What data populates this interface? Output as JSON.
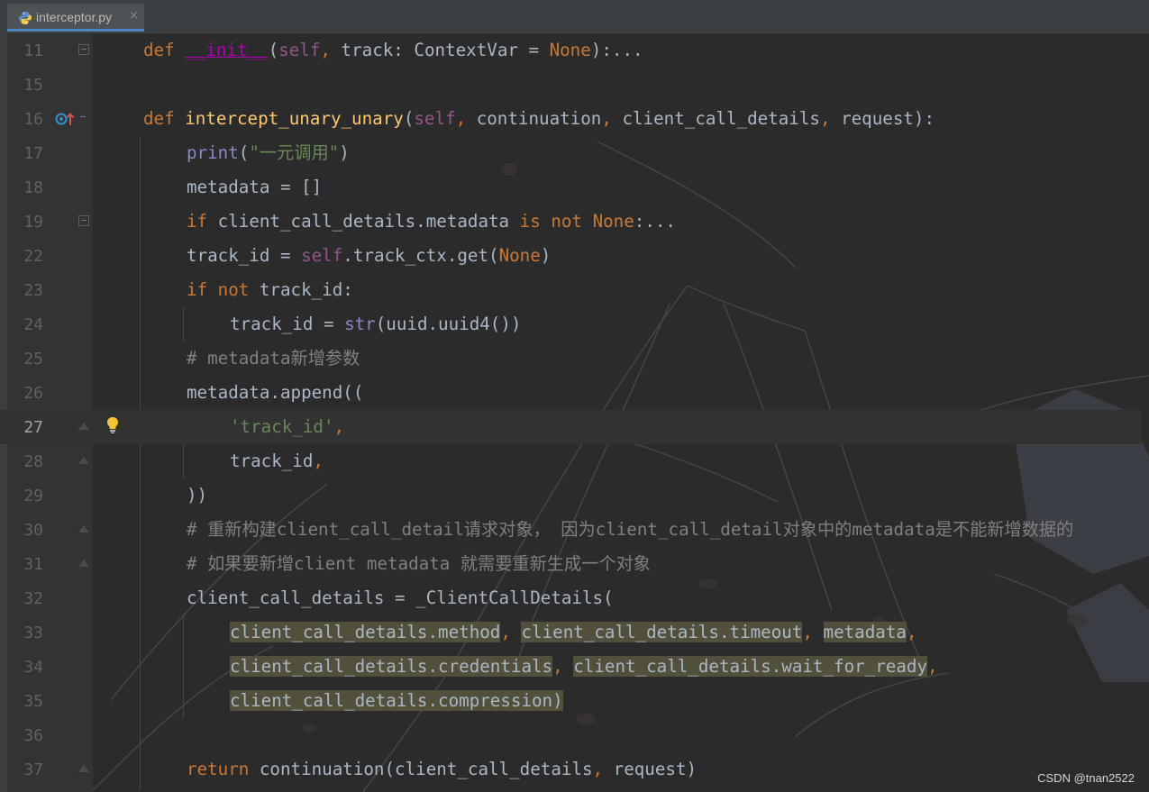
{
  "tab": {
    "title": "interceptor.py",
    "close": "×"
  },
  "editor": {
    "current_line": "27",
    "lines": [
      {
        "n": "11"
      },
      {
        "n": "15"
      },
      {
        "n": "16"
      },
      {
        "n": "17"
      },
      {
        "n": "18"
      },
      {
        "n": "19"
      },
      {
        "n": "22"
      },
      {
        "n": "23"
      },
      {
        "n": "24"
      },
      {
        "n": "25"
      },
      {
        "n": "26"
      },
      {
        "n": "27"
      },
      {
        "n": "28"
      },
      {
        "n": "29"
      },
      {
        "n": "30"
      },
      {
        "n": "31"
      },
      {
        "n": "32"
      },
      {
        "n": "33"
      },
      {
        "n": "34"
      },
      {
        "n": "35"
      },
      {
        "n": "36"
      },
      {
        "n": "37"
      }
    ],
    "code": {
      "l11": {
        "def": "def",
        "sp1": " ",
        "name": "__init__",
        "p1": "(",
        "self": "self",
        "comma": ",",
        "rest": " track: ContextVar = ",
        "none": "None",
        "tail": "):..."
      },
      "l16": {
        "def": "def",
        "sp1": " ",
        "name": "intercept_unary_unary",
        "p1": "(",
        "self": "self",
        "c1": ",",
        "a1": " continuation",
        "c2": ",",
        "a2": " client_call_details",
        "c3": ",",
        "a3": " request):"
      },
      "l17": {
        "fn": "print",
        "p1": "(",
        "str": "\"一元调用\"",
        "p2": ")"
      },
      "l18": {
        "text": "metadata = []"
      },
      "l19": {
        "if": "if",
        "mid": " client_call_details.metadata ",
        "is": "is",
        "sp": " ",
        "not": "not",
        "sp2": " ",
        "none": "None",
        "tail": ":..."
      },
      "l22": {
        "a": "track_id = ",
        "self": "self",
        "b": ".track_ctx.get(",
        "none": "None",
        "c": ")"
      },
      "l23": {
        "if": "if",
        "sp": " ",
        "not": "not",
        "rest": " track_id:"
      },
      "l24": {
        "a": "track_id = ",
        "str": "str",
        "b": "(uuid.uuid4())"
      },
      "l25": {
        "cmt": "# metadata新增参数"
      },
      "l26": {
        "text": "metadata.append(("
      },
      "l27": {
        "str": "'track_id'",
        "comma": ","
      },
      "l28": {
        "text": "track_id",
        "comma": ","
      },
      "l29": {
        "text": "))"
      },
      "l30": {
        "cmt": "# 重新构建client_call_detail请求对象， 因为client_call_detail对象中的metadata是不能新增数据的"
      },
      "l31": {
        "cmt": "# 如果要新增client metadata 就需要重新生成一个对象"
      },
      "l32": {
        "text": "client_call_details = _ClientCallDetails("
      },
      "l33": {
        "a": "client_call_details.method",
        "c1": ",",
        "sp1": " ",
        "b": "client_call_details.timeout",
        "c2": ",",
        "sp2": " ",
        "c": "metadata",
        "c3": ","
      },
      "l34": {
        "a": "client_call_details.credentials",
        "c1": ",",
        "sp1": " ",
        "b": "client_call_details.wait_for_ready",
        "c2": ","
      },
      "l35": {
        "a": "client_call_details.compression",
        "b": ")"
      },
      "l37": {
        "ret": "return",
        "a": " continuation(client_call_details",
        "c": ",",
        "b": " request)"
      }
    }
  },
  "watermark": "CSDN @tnan2522",
  "colors": {
    "keyword": "#cc7832",
    "self": "#94558d",
    "function": "#ffc66d",
    "builtin": "#8888c6",
    "string": "#6a8759",
    "comment": "#808080",
    "text": "#a9b7c6",
    "background": "#2b2b2b"
  }
}
